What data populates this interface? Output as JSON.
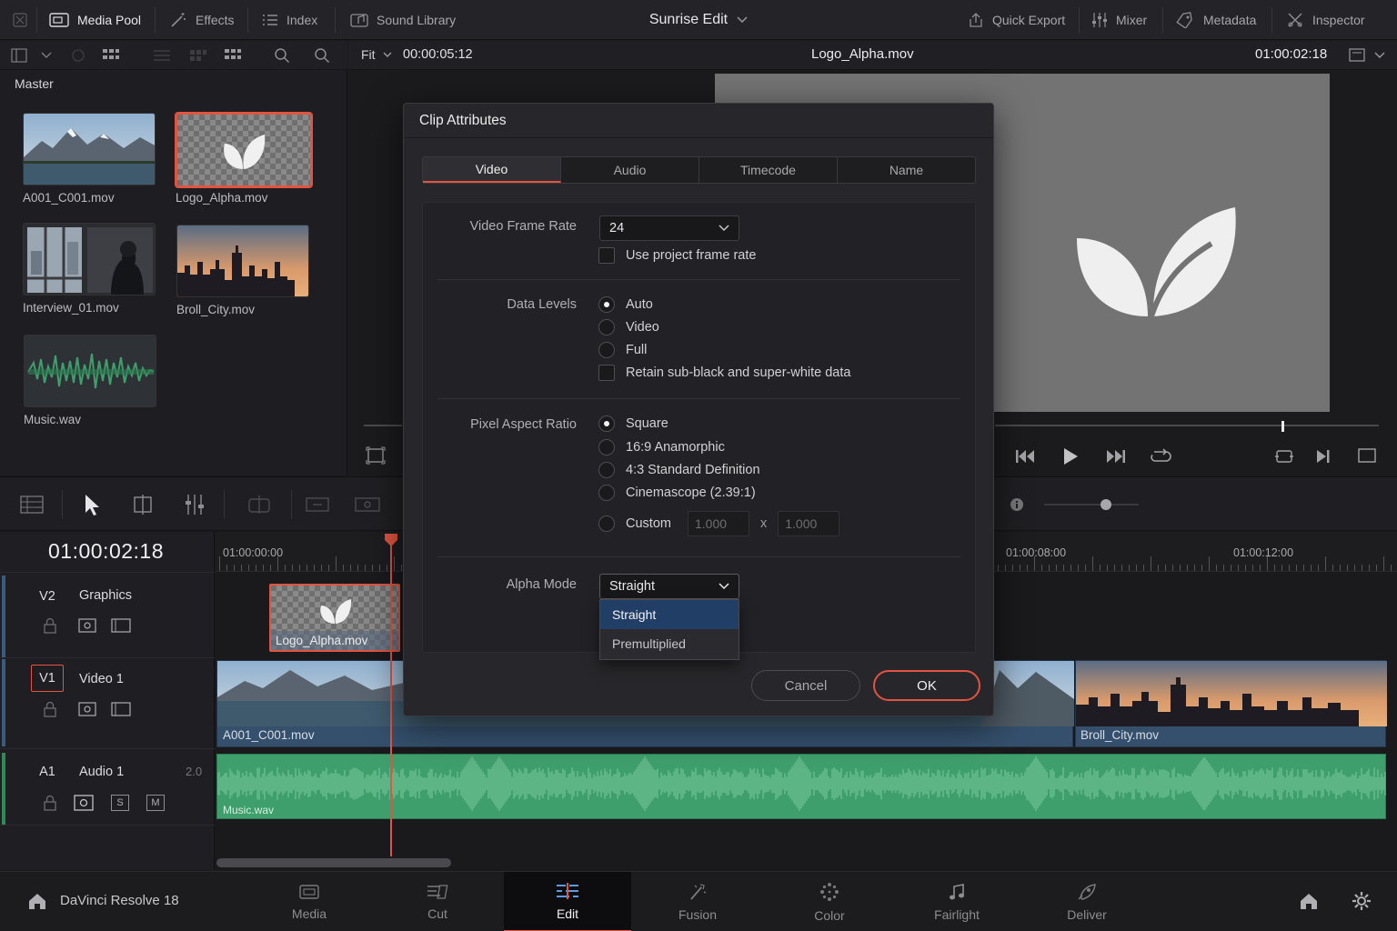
{
  "topbar": {
    "media_pool": "Media Pool",
    "effects": "Effects",
    "index": "Index",
    "sound_library": "Sound Library",
    "project_title": "Sunrise Edit",
    "quick_export": "Quick Export",
    "mixer": "Mixer",
    "metadata": "Metadata",
    "inspector": "Inspector"
  },
  "media_pool": {
    "bin": "Master",
    "clips": [
      {
        "name": "A001_C001.mov"
      },
      {
        "name": "Logo_Alpha.mov",
        "selected": true
      },
      {
        "name": "Interview_01.mov"
      },
      {
        "name": "Broll_City.mov"
      },
      {
        "name": "Music.wav"
      }
    ]
  },
  "viewer": {
    "zoom": "Fit",
    "source_duration": "00:00:05:12",
    "clip_name": "Logo_Alpha.mov",
    "timecode": "01:00:02:18"
  },
  "timeline": {
    "current_timecode": "01:00:02:18",
    "ruler_labels": [
      "01:00:00:00",
      "01:00:08:00",
      "01:00:12:00"
    ],
    "tracks": [
      {
        "id": "V2",
        "name": "Graphics"
      },
      {
        "id": "V1",
        "name": "Video 1"
      },
      {
        "id": "A1",
        "name": "Audio 1",
        "channels": "2.0",
        "solo": "S",
        "mute": "M"
      }
    ],
    "clips": {
      "logo": "Logo_Alpha.mov",
      "a001": "A001_C001.mov",
      "broll": "Broll_City.mov",
      "music": "Music.wav"
    }
  },
  "dialog": {
    "title": "Clip Attributes",
    "tabs": [
      "Video",
      "Audio",
      "Timecode",
      "Name"
    ],
    "active_tab": "Video",
    "video_frame_rate": {
      "label": "Video Frame Rate",
      "value": "24",
      "use_project_label": "Use project frame rate"
    },
    "data_levels": {
      "label": "Data Levels",
      "options": [
        "Auto",
        "Video",
        "Full"
      ],
      "selected": "Auto",
      "retain_label": "Retain sub-black and super-white data"
    },
    "pixel_aspect": {
      "label": "Pixel Aspect Ratio",
      "options": [
        "Square",
        "16:9 Anamorphic",
        "4:3 Standard Definition",
        "Cinemascope (2.39:1)",
        "Custom"
      ],
      "selected": "Square",
      "custom_w": "1.000",
      "custom_x": "x",
      "custom_h": "1.000"
    },
    "alpha_mode": {
      "label": "Alpha Mode",
      "value": "Straight",
      "options": [
        "Straight",
        "Premultiplied"
      ],
      "highlighted": "Straight"
    },
    "cancel": "Cancel",
    "ok": "OK"
  },
  "bottombar": {
    "app_name": "DaVinci Resolve 18",
    "pages": [
      "Media",
      "Cut",
      "Edit",
      "Fusion",
      "Color",
      "Fairlight",
      "Deliver"
    ],
    "active_page": "Edit"
  },
  "colors": {
    "accent": "#e2543f",
    "audio_clip": "#3f9f6c",
    "video_clip_bar": "#3a5878",
    "highlight": "#213f66"
  }
}
